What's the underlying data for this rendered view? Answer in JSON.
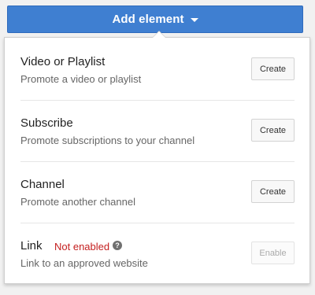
{
  "add_element": {
    "label": "Add element"
  },
  "menu": {
    "items": [
      {
        "title": "Video or Playlist",
        "description": "Promote a video or playlist",
        "button": "Create"
      },
      {
        "title": "Subscribe",
        "description": "Promote subscriptions to your channel",
        "button": "Create"
      },
      {
        "title": "Channel",
        "description": "Promote another channel",
        "button": "Create"
      },
      {
        "title": "Link",
        "status": "Not enabled",
        "description": "Link to an approved website",
        "button": "Enable",
        "button_disabled": true
      }
    ]
  },
  "colors": {
    "primary_button": "#3f7fd1",
    "status_error": "#c41f1f"
  },
  "icons": {
    "help": "?"
  }
}
